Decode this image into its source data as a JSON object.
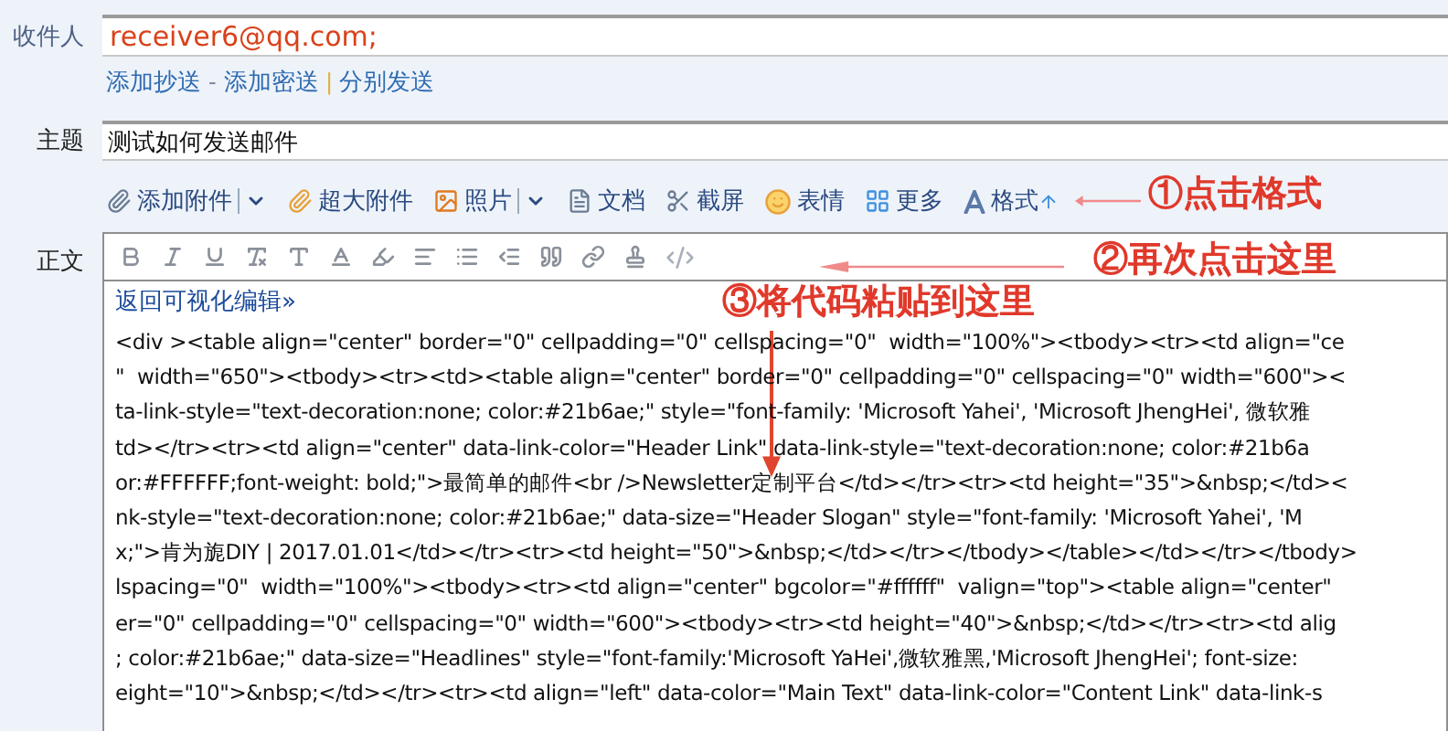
{
  "recipient": {
    "label": "收件人",
    "value": "receiver6@qq.com;"
  },
  "recipient_links": [
    {
      "kind": "link",
      "text": "添加抄送"
    },
    {
      "kind": "sep",
      "text": "-"
    },
    {
      "kind": "link",
      "text": "添加密送"
    },
    {
      "kind": "sep",
      "text": "|"
    },
    {
      "kind": "link",
      "text": "分别发送"
    }
  ],
  "subject": {
    "label": "主题",
    "value": "测试如何发送邮件"
  },
  "attach_toolbar": [
    {
      "kind": "paperclip",
      "label": "添加附件",
      "dropdown": true
    },
    {
      "kind": "big-clip",
      "label": "超大附件",
      "dropdown": false
    },
    {
      "kind": "photo",
      "label": "照片",
      "dropdown": true
    },
    {
      "kind": "document",
      "label": "文档",
      "dropdown": false
    },
    {
      "kind": "scissors",
      "label": "截屏",
      "dropdown": false
    },
    {
      "kind": "smiley",
      "label": "表情",
      "dropdown": false
    },
    {
      "kind": "grid",
      "label": "更多",
      "dropdown": false
    },
    {
      "kind": "format",
      "label": "格式",
      "dropdown": false
    }
  ],
  "body": {
    "label": "正文",
    "back_link": "返回可视化编辑»",
    "code_lines": [
      "<div ><table align=\"center\" border=\"0\" cellpadding=\"0\" cellspacing=\"0\"  width=\"100%\"><tbody><tr><td align=\"ce",
      "\"  width=\"650\"><tbody><tr><td><table align=\"center\" border=\"0\" cellpadding=\"0\" cellspacing=\"0\" width=\"600\"><",
      "ta-link-style=\"text-decoration:none; color:#21b6ae;\" style=\"font-family: 'Microsoft Yahei', 'Microsoft JhengHei', 微软雅",
      "td></tr><tr><td align=\"center\" data-link-color=\"Header Link\" data-link-style=\"text-decoration:none; color:#21b6a",
      "or:#FFFFFF;font-weight: bold;\">最简单的邮件<br />Newsletter定制平台</td></tr><tr><td height=\"35\">&nbsp;</td><",
      "nk-style=\"text-decoration:none; color:#21b6ae;\" data-size=\"Header Slogan\" style=\"font-family: 'Microsoft Yahei', 'M",
      "x;\">肯为旎DIY | 2017.01.01</td></tr><tr><td height=\"50\">&nbsp;</td></tr></tbody></table></td></tr></tbody>",
      "lspacing=\"0\"  width=\"100%\"><tbody><tr><td align=\"center\" bgcolor=\"#ffffff\"  valign=\"top\"><table align=\"center\"",
      "er=\"0\" cellpadding=\"0\" cellspacing=\"0\" width=\"600\"><tbody><tr><td height=\"40\">&nbsp;</td></tr><tr><td alig",
      "; color:#21b6ae;\" data-size=\"Headlines\" style=\"font-family:'Microsoft YaHei',微软雅黑,'Microsoft JhengHei'; font-size:",
      "eight=\"10\">&nbsp;</td></tr><tr><td align=\"left\" data-color=\"Main Text\" data-link-color=\"Content Link\" data-link-s"
    ]
  },
  "annotations": [
    {
      "kind": "left",
      "text": "①点击格式"
    },
    {
      "kind": "left",
      "text": "②再次点击这里"
    },
    {
      "kind": "down",
      "text": "③将代码粘贴到这里"
    }
  ]
}
